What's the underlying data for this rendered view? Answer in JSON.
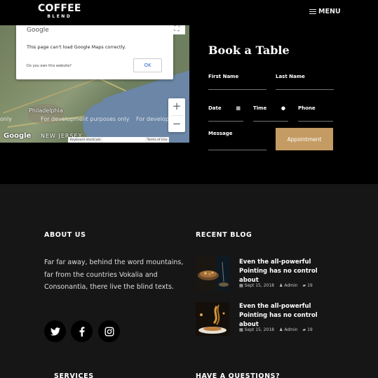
{
  "navbar": {
    "brand_top": "COFFEE",
    "brand_bottom": "BLEND",
    "menu_label": "MENU"
  },
  "map": {
    "popup_logo": "Google",
    "popup_message": "This page can't load Google Maps correctly.",
    "popup_own_site": "Do you own this website?",
    "popup_ok": "OK",
    "label_philadelphia": "Philadelphia",
    "label_new_jersey": "NEW JERSEY",
    "label_ny": "only",
    "dev_text_1": "For development purposes only",
    "dev_text_2": "For develop",
    "footer_logo": "Google",
    "keyboard": "Keyboard shortcuts",
    "terms": "Terms of Use",
    "zoom_in": "+",
    "zoom_out": "−"
  },
  "booking": {
    "title": "Book a Table",
    "first_name": "First Name",
    "last_name": "Last Name",
    "date": "Date",
    "time": "Time",
    "phone": "Phone",
    "message": "Message",
    "button": "Appointment"
  },
  "footer": {
    "about_title": "ABOUT US",
    "about_text": "Far far away, behind the word mountains, far from the countries Vokalia and Consonantia, there live the blind texts.",
    "blog_title": "RECENT BLOG",
    "services_title": "SERVICES",
    "question_title": "HAVE A QUESTIONS?",
    "posts": [
      {
        "title": "Even the all-powerful Pointing has no control about",
        "date": "Sept 15, 2018",
        "author": "Admin",
        "comments": "19"
      },
      {
        "title": "Even the all-powerful Pointing has no control about",
        "date": "Sept 15, 2018",
        "author": "Admin",
        "comments": "19"
      }
    ]
  },
  "colors": {
    "accent": "#c49b63",
    "footer_bg": "#161616",
    "page_bg": "#000000"
  },
  "icons": [
    "menu-icon",
    "calendar-icon",
    "clock-icon",
    "twitter-icon",
    "facebook-icon",
    "instagram-icon",
    "calendar-meta-icon",
    "user-icon",
    "comment-icon"
  ]
}
